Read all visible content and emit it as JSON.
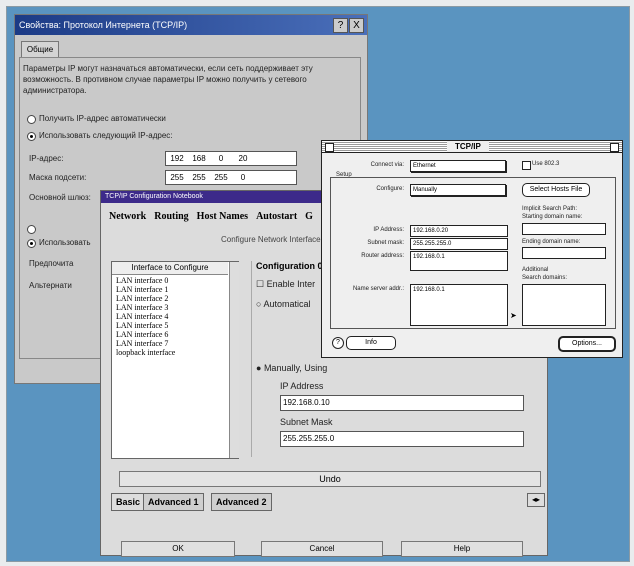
{
  "colors": {
    "background": "#5a94c0",
    "win_title": "#1c3b86",
    "notebook_title": "#3c2a8a"
  },
  "win": {
    "title": "Свойства: Протокол Интернета (TCP/IP)",
    "help_btn": "?",
    "close_btn": "X",
    "tab": "Общие",
    "description": "Параметры IP могут назначаться автоматически, если сеть поддерживает эту возможность. В противном случае параметры IP можно получить у сетевого администратора.",
    "radio_auto": "Получить IP-адрес автоматически",
    "radio_manual": "Использовать следующий IP-адрес:",
    "ip_label": "IP-адрес:",
    "ip": [
      "192",
      "168",
      "0",
      "20"
    ],
    "mask_label": "Маска подсети:",
    "mask": [
      "255",
      "255",
      "255",
      "0"
    ],
    "gateway_label": "Основной шлюз:",
    "dns_radio_manual": "Использовать",
    "preferred_label": "Предпочита",
    "alternate_label": "Альтернати"
  },
  "notebook": {
    "title": "TCP/IP Configuration Notebook",
    "tabs": [
      "Network",
      "Routing",
      "Host Names",
      "Autostart",
      "G"
    ],
    "configure_text": "Configure Network Interface",
    "list_header": "Interface to Configure",
    "interfaces": [
      "LAN interface 0",
      "LAN interface 1",
      "LAN interface 2",
      "LAN interface 3",
      "LAN interface 4",
      "LAN interface 5",
      "LAN interface 6",
      "LAN interface 7",
      "loopback interface"
    ],
    "config_title": "Configuration 0",
    "enable": "Enable Inter",
    "automatic": "Automatical",
    "manual": "Manually, Using",
    "ip_label": "IP Address",
    "ip": "192.168.0.10",
    "mask_label": "Subnet Mask",
    "mask": "255.255.255.0",
    "undo": "Undo",
    "bottom_tabs": [
      "Basic",
      "Advanced 1",
      "Advanced 2"
    ],
    "ok": "OK",
    "cancel": "Cancel",
    "help": "Help"
  },
  "mac": {
    "title": "TCP/IP",
    "connect_label": "Connect via:",
    "connect_value": "Ethernet",
    "use8023": "Use 802.3",
    "setup": "Setup",
    "configure_label": "Configure:",
    "configure_value": "Manually",
    "hosts_btn": "Select Hosts File",
    "implicit": "Implicit Search Path:",
    "starting_domain": "Starting domain name:",
    "ip_label": "IP Address:",
    "ip": "192.168.0.20",
    "mask_label": "Subnet mask:",
    "mask": "255.255.255.0",
    "router_label": "Router address:",
    "router": "192.168.0.1",
    "ending_domain": "Ending domain name:",
    "additional": "Additional",
    "search_domains": "Search domains:",
    "ns_label": "Name server addr.:",
    "ns": "192.168.0.1",
    "info": "Info",
    "options": "Options..."
  }
}
